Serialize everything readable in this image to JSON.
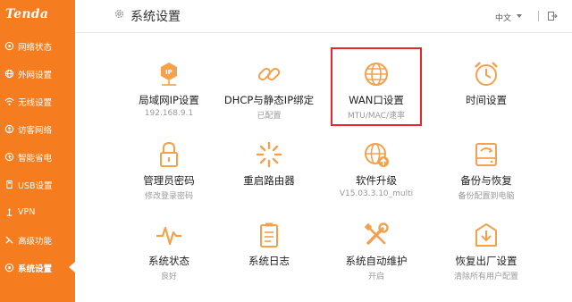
{
  "brand": {
    "logo_text": "Tenda",
    "accent": "#f57c1f",
    "highlight": "#e8262b"
  },
  "sidebar": {
    "items": [
      {
        "label": "网络状态",
        "icon": "network-status-icon"
      },
      {
        "label": "外网设置",
        "icon": "globe-icon"
      },
      {
        "label": "无线设置",
        "icon": "wifi-icon"
      },
      {
        "label": "访客网络",
        "icon": "guest-icon"
      },
      {
        "label": "智能省电",
        "icon": "power-save-icon"
      },
      {
        "label": "USB设置",
        "icon": "usb-icon"
      },
      {
        "label": "VPN",
        "icon": "vpn-icon"
      },
      {
        "label": "高级功能",
        "icon": "tools-icon"
      },
      {
        "label": "系统设置",
        "icon": "settings-icon",
        "active": true
      }
    ]
  },
  "header": {
    "title": "系统设置",
    "language": "中文",
    "logout_label": "退出"
  },
  "tiles": [
    {
      "label": "局域网IP设置",
      "sub": "192.168.9.1",
      "icon": "lan-ip-icon"
    },
    {
      "label": "DHCP与静态IP绑定",
      "sub": "已配置",
      "icon": "link-icon"
    },
    {
      "label": "WAN口设置",
      "sub": "MTU/MAC/速率",
      "icon": "globe-icon",
      "highlighted": true
    },
    {
      "label": "时间设置",
      "sub": "",
      "icon": "clock-icon"
    },
    {
      "label": "管理员密码",
      "sub": "修改登录密码",
      "icon": "lock-icon"
    },
    {
      "label": "重启路由器",
      "sub": "",
      "icon": "reboot-spinner-icon"
    },
    {
      "label": "软件升级",
      "sub": "V15.03.3.10_multi",
      "icon": "upgrade-icon"
    },
    {
      "label": "备份与恢复",
      "sub": "备份配置到电脑",
      "icon": "backup-icon"
    },
    {
      "label": "系统状态",
      "sub": "良好",
      "icon": "pulse-icon"
    },
    {
      "label": "系统日志",
      "sub": "",
      "icon": "log-icon"
    },
    {
      "label": "系统自动维护",
      "sub": "开启",
      "icon": "wrench-screwdriver-icon"
    },
    {
      "label": "恢复出厂设置",
      "sub": "清除所有用户配置",
      "icon": "factory-reset-icon"
    }
  ]
}
